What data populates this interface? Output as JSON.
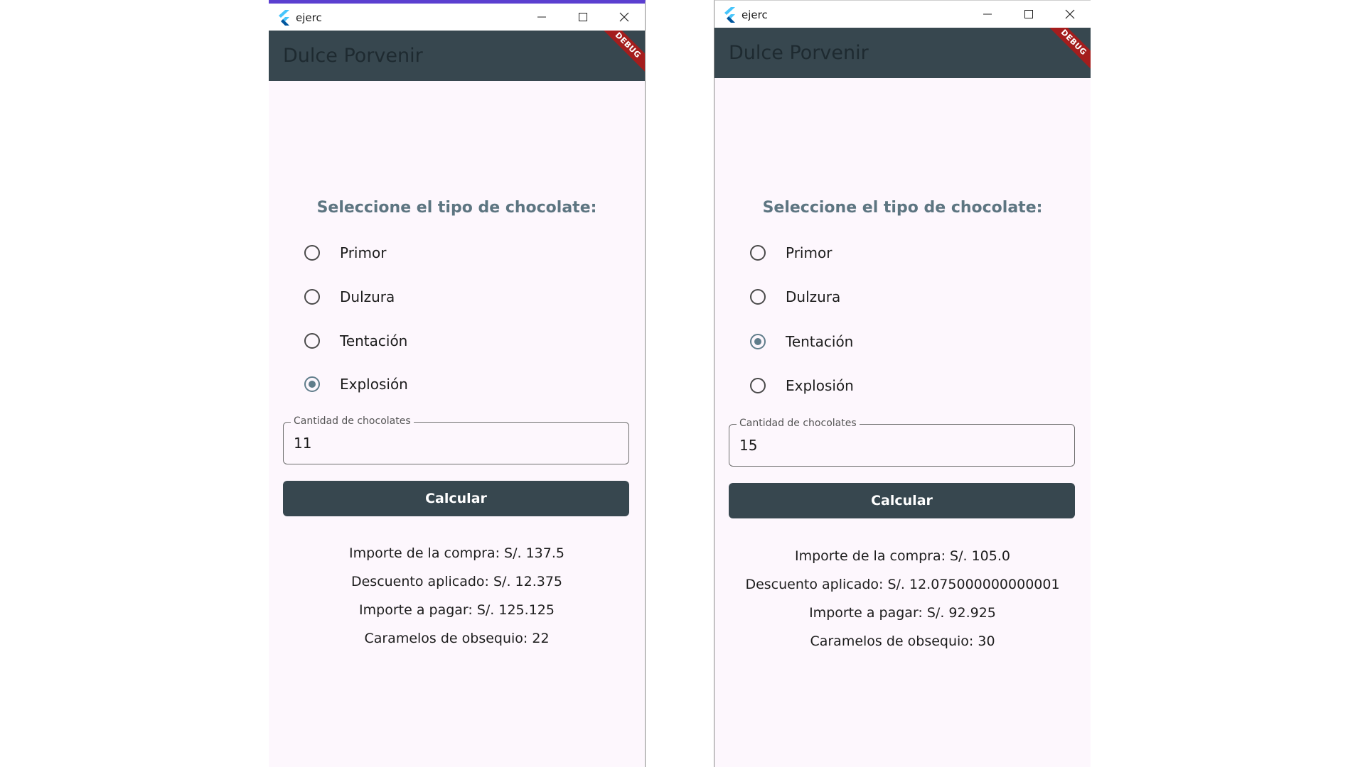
{
  "colors": {
    "appbar": "#37474f",
    "background": "#fdf7fd",
    "accent": "#607d8b",
    "heading": "#5d7581",
    "debug_banner": "#a41d1d",
    "left_window_border": "#5b3fd0"
  },
  "windows": [
    {
      "window_title": "ejerc",
      "app_title": "Dulce Porvenir",
      "debug_label": "DEBUG",
      "heading": "Seleccione el tipo de chocolate:",
      "options": [
        {
          "label": "Primor",
          "selected": false
        },
        {
          "label": "Dulzura",
          "selected": false
        },
        {
          "label": "Tentación",
          "selected": false
        },
        {
          "label": "Explosión",
          "selected": true
        }
      ],
      "quantity_label": "Cantidad de chocolates",
      "quantity_value": "11",
      "button_label": "Calcular",
      "results": [
        "Importe de la compra: S/. 137.5",
        "Descuento aplicado: S/. 12.375",
        "Importe a pagar: S/. 125.125",
        "Caramelos de obsequio: 22"
      ]
    },
    {
      "window_title": "ejerc",
      "app_title": "Dulce Porvenir",
      "debug_label": "DEBUG",
      "heading": "Seleccione el tipo de chocolate:",
      "options": [
        {
          "label": "Primor",
          "selected": false
        },
        {
          "label": "Dulzura",
          "selected": false
        },
        {
          "label": "Tentación",
          "selected": true
        },
        {
          "label": "Explosión",
          "selected": false
        }
      ],
      "quantity_label": "Cantidad de chocolates",
      "quantity_value": "15",
      "button_label": "Calcular",
      "results": [
        "Importe de la compra: S/. 105.0",
        "Descuento aplicado: S/. 12.075000000000001",
        "Importe a pagar: S/. 92.925",
        "Caramelos de obsequio: 30"
      ]
    }
  ],
  "icons": {
    "app_icon": "flutter-logo-icon",
    "minimize": "minimize-icon",
    "maximize": "maximize-icon",
    "close": "close-icon"
  }
}
